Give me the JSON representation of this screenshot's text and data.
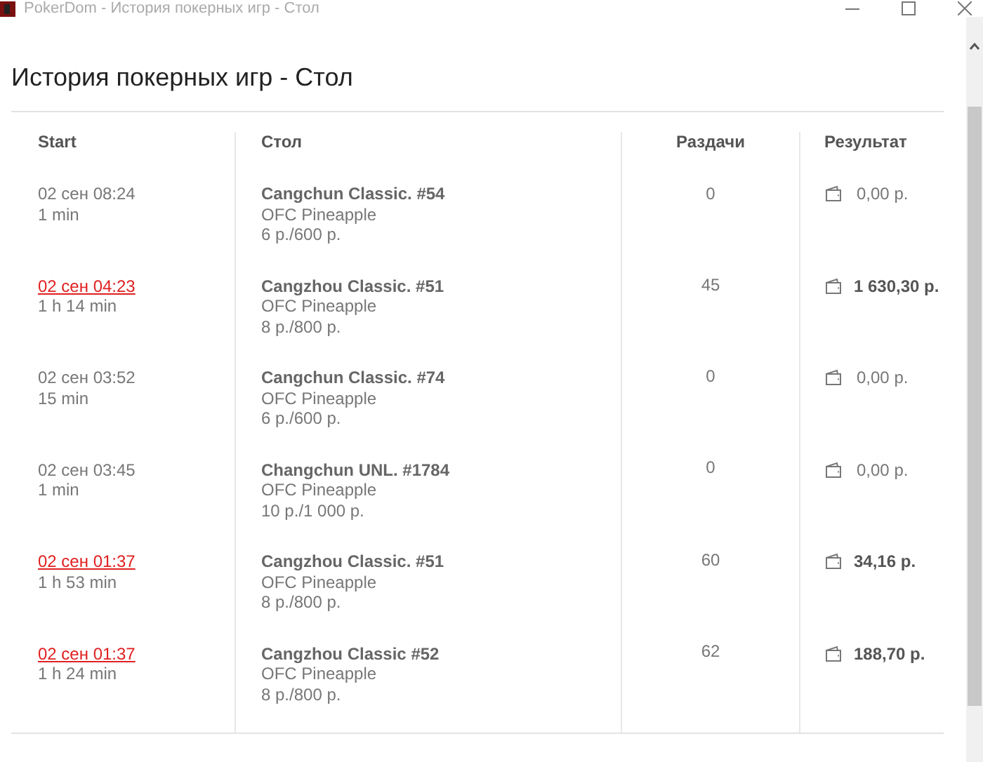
{
  "window": {
    "title": "PokerDom - История покерных игр - Стол"
  },
  "heading": "История покерных игр - Стол",
  "table": {
    "columns": [
      "Start",
      "Стол",
      "Раздачи",
      "Результат"
    ],
    "rows": [
      {
        "date": "02 сен 08:24",
        "duration": "1 min",
        "table": "Cangchun Classic. #54",
        "game": "OFC Pineapple",
        "stakes": "6 р./600 р.",
        "hands": "0",
        "result": "0,00 р.",
        "highlighted": false
      },
      {
        "date": "02 сен 04:23",
        "duration": "1 h 14 min",
        "table": "Cangzhou Classic. #51",
        "game": "OFC Pineapple",
        "stakes": "8 р./800 р.",
        "hands": "45",
        "result": "1 630,30 р.",
        "highlighted": true
      },
      {
        "date": "02 сен 03:52",
        "duration": "15 min",
        "table": "Cangchun Classic. #74",
        "game": "OFC Pineapple",
        "stakes": "6 р./600 р.",
        "hands": "0",
        "result": "0,00 р.",
        "highlighted": false
      },
      {
        "date": "02 сен 03:45",
        "duration": "1 min",
        "table": "Changchun UNL. #1784",
        "game": "OFC Pineapple",
        "stakes": "10 р./1 000 р.",
        "hands": "0",
        "result": "0,00 р.",
        "highlighted": false
      },
      {
        "date": "02 сен 01:37",
        "duration": "1 h 53 min",
        "table": "Cangzhou Classic. #51",
        "game": "OFC Pineapple",
        "stakes": "8 р./800 р.",
        "hands": "60",
        "result": "34,16 р.",
        "highlighted": true
      },
      {
        "date": "02 сен 01:37",
        "duration": "1 h 24 min",
        "table": "Cangzhou Classic #52",
        "game": "OFC Pineapple",
        "stakes": "8 р./800 р.",
        "hands": "62",
        "result": "188,70 р.",
        "highlighted": true
      }
    ]
  }
}
